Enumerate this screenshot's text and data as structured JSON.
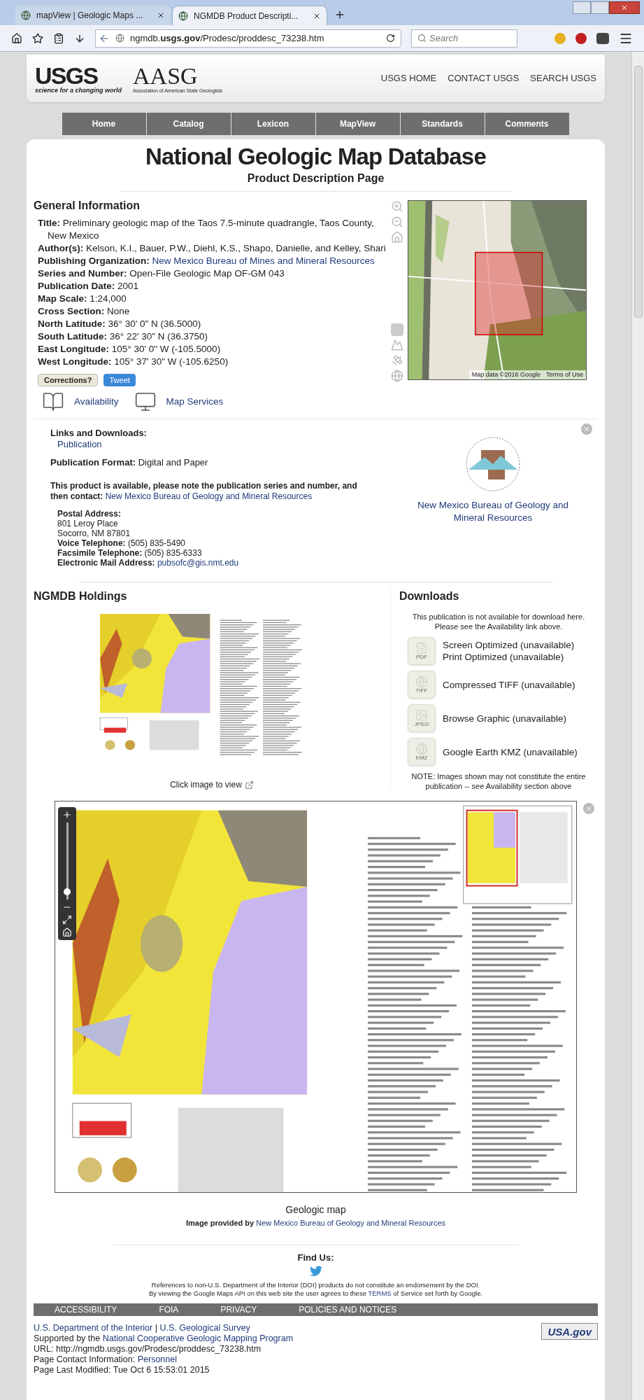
{
  "browser": {
    "tabs": [
      {
        "label": "mapView | Geologic Maps ...",
        "selected": false
      },
      {
        "label": "NGMDB Product Descripti...",
        "selected": true
      }
    ],
    "url": "ngmdb.**usgs.gov**/Prodesc/proddesc_73238.htm",
    "search_placeholder": "Search"
  },
  "header": {
    "usgs_logo": "USGS",
    "usgs_tagline": "science for a changing world",
    "aasg_logo": "AASG",
    "aasg_tagline": "Association of American State Geologists",
    "links": [
      "USGS HOME",
      "CONTACT USGS",
      "SEARCH USGS"
    ]
  },
  "nav": [
    "Home",
    "Catalog",
    "Lexicon",
    "MapView",
    "Standards",
    "Comments"
  ],
  "page_title": "National Geologic Map Database",
  "page_subtitle": "Product Description Page",
  "general": {
    "heading": "General Information",
    "fields": [
      {
        "label": "Title:",
        "value": "Preliminary geologic map of the Taos 7.5-minute quadrangle, Taos County, New Mexico",
        "kind": "text"
      },
      {
        "label": "Author(s):",
        "value": "Kelson, K.I., Bauer, P.W., Diehl, K.S., Shapo, Danielle, and Kelley, Shari",
        "kind": "text"
      },
      {
        "label": "Publishing Organization:",
        "value": "New Mexico Bureau of Mines and Mineral Resources",
        "kind": "link"
      },
      {
        "label": "Series and Number:",
        "value": "Open-File Geologic Map OF-GM 043",
        "kind": "text"
      },
      {
        "label": "Publication Date:",
        "value": "2001",
        "kind": "text"
      },
      {
        "label": "Map Scale:",
        "value": "1:24,000",
        "kind": "text"
      },
      {
        "label": "Cross Section:",
        "value": "None",
        "kind": "text"
      },
      {
        "label": "North Latitude:",
        "value": "36° 30' 0\" N (36.5000)",
        "kind": "text"
      },
      {
        "label": "South Latitude:",
        "value": "36° 22' 30\" N (36.3750)",
        "kind": "text"
      },
      {
        "label": "East Longitude:",
        "value": "105° 30' 0\" W (-105.5000)",
        "kind": "text"
      },
      {
        "label": "West Longitude:",
        "value": "105° 37' 30\" W (-105.6250)",
        "kind": "text"
      }
    ],
    "corrections_button": "Corrections?",
    "tweet_button": "Tweet",
    "availability_link": "Availability",
    "map_services_link": "Map Services",
    "map": {
      "attribution": "Map data ©2016 Google",
      "terms": "Terms of Use"
    }
  },
  "links": {
    "heading": "Links and Downloads:",
    "publication_link": "Publication",
    "format_label": "Publication Format:",
    "format_value": "Digital and Paper",
    "availability_note": "This product is available, please note the publication series and number, and then contact:",
    "contact_link": "New Mexico Bureau of Geology and Mineral Resources",
    "address": [
      {
        "label": "Postal Address:",
        "kind": "text"
      },
      {
        "value": "801 Leroy Place",
        "kind": "text"
      },
      {
        "value": "Socorro, NM 87801",
        "kind": "text"
      },
      {
        "label": "Voice Telephone:",
        "value": "(505) 835-5490",
        "kind": "text"
      },
      {
        "label": "Facsimile Telephone:",
        "value": "(505) 835-6333",
        "kind": "text"
      },
      {
        "label": "Electronic Mail Address:",
        "value": "pubsofc@gis.nmt.edu",
        "kind": "link"
      }
    ],
    "org_link": "New Mexico Bureau of Geology and Mineral Resources"
  },
  "holdings": {
    "heading": "NGMDB Holdings",
    "click_note": "Click image to view"
  },
  "downloads": {
    "heading": "Downloads",
    "note": [
      "This publication is not available for download here.",
      "Please see the Availability link above."
    ],
    "items": [
      {
        "kind": "pdf",
        "icon_label": "PDF",
        "lines": [
          "Screen Optimized (unavailable)",
          "Print Optimized (unavailable)"
        ]
      },
      {
        "kind": "tiff",
        "icon_label": "TIFF",
        "lines": [
          "Compressed TIFF (unavailable)"
        ]
      },
      {
        "kind": "jpeg",
        "icon_label": "JPEG",
        "lines": [
          "Browse Graphic (unavailable)"
        ]
      },
      {
        "kind": "kmz",
        "icon_label": "KMZ",
        "lines": [
          "Google Earth KMZ (unavailable)"
        ]
      }
    ],
    "footnote": [
      "NOTE: Images shown may not constitute the entire",
      "publication -- see Availability section above"
    ]
  },
  "viewer": {
    "zoom": {
      "level": 0.1
    },
    "caption": "Geologic map",
    "credit_prefix": "Image provided by",
    "credit_link": "New Mexico Bureau of Geology and Mineral Resources"
  },
  "find_us": "Find Us:",
  "disclaimer": [
    "References to non-U.S. Department of the Interior (DOI) products do not constitute an endorsement by the DOI."
  ],
  "terms_line": {
    "before": "By viewing the Google Maps API on this web site the user agrees to these",
    "link": "TERMS",
    "after": "of Service set forth by Google."
  },
  "footer_links": [
    "ACCESSIBILITY",
    "FOIA",
    "PRIVACY",
    "POLICIES AND NOTICES"
  ],
  "footer_lines": [
    [
      {
        "text": "U.S. Department of the Interior",
        "kind": "link"
      },
      {
        "text": "|",
        "kind": "text"
      },
      {
        "text": "U.S. Geological Survey",
        "kind": "link"
      }
    ],
    [
      {
        "text": "Supported by the",
        "kind": "text"
      },
      {
        "text": "National Cooperative Geologic Mapping Program",
        "kind": "link"
      }
    ],
    [
      {
        "text": "URL: http://ngmdb.usgs.gov/Prodesc/proddesc_73238.htm",
        "kind": "text"
      }
    ],
    [
      {
        "text": "Page Contact Information:",
        "kind": "text"
      },
      {
        "text": "Personnel",
        "kind": "link"
      }
    ],
    [
      {
        "text": "Page Last Modified: Tue Oct 6 15:53:01 2015",
        "kind": "text"
      }
    ]
  ],
  "usa_gov": "USA.gov"
}
